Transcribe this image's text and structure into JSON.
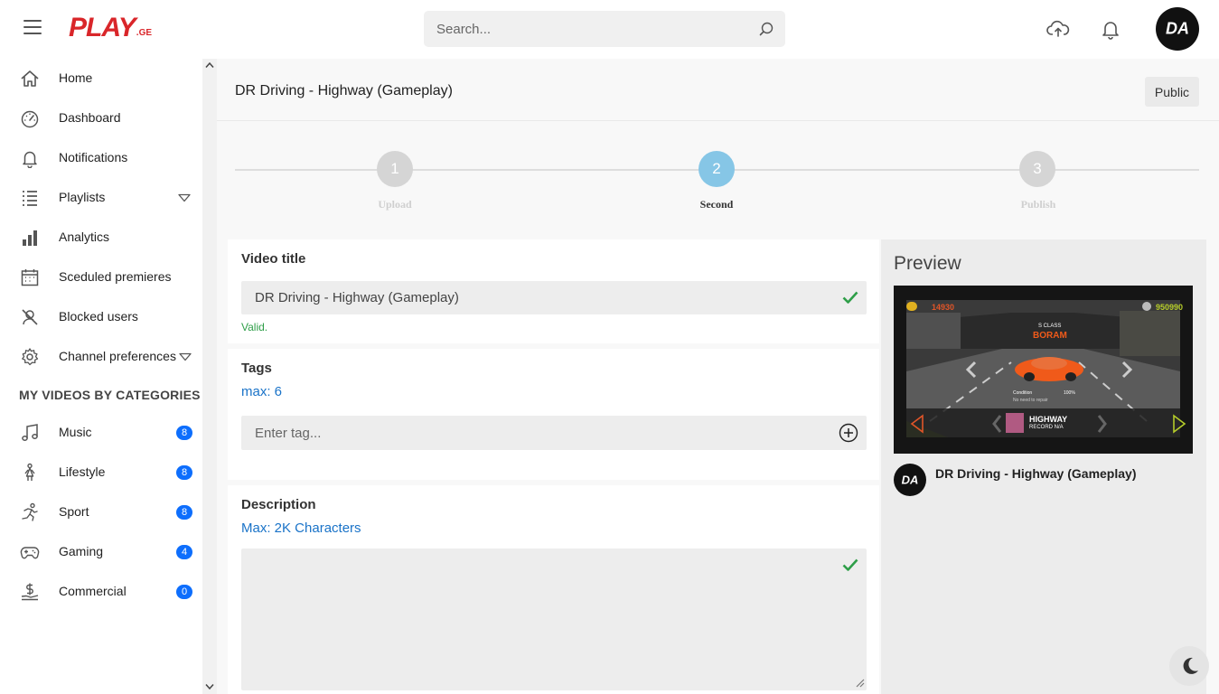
{
  "brand": {
    "logo_text": "PLAY",
    "logo_suffix": ".GE",
    "avatar_text": "DA"
  },
  "search": {
    "placeholder": "Search..."
  },
  "sidebar": {
    "items": [
      {
        "label": "Home",
        "icon": "home-icon"
      },
      {
        "label": "Dashboard",
        "icon": "speedometer-icon"
      },
      {
        "label": "Notifications",
        "icon": "bell-icon"
      },
      {
        "label": "Playlists",
        "icon": "list-icon"
      },
      {
        "label": "Analytics",
        "icon": "bar-chart-icon"
      },
      {
        "label": "Sceduled premieres",
        "icon": "calendar-icon"
      },
      {
        "label": "Blocked users",
        "icon": "blocked-user-icon"
      },
      {
        "label": "Channel preferences",
        "icon": "gear-icon"
      }
    ],
    "section_title": "MY VIDEOS BY CATEGORIES",
    "categories": [
      {
        "label": "Music",
        "count": "8",
        "icon": "music-icon"
      },
      {
        "label": "Lifestyle",
        "count": "8",
        "icon": "lifestyle-icon"
      },
      {
        "label": "Sport",
        "count": "8",
        "icon": "running-icon"
      },
      {
        "label": "Gaming",
        "count": "4",
        "icon": "gamepad-icon"
      },
      {
        "label": "Commercial",
        "count": "0",
        "icon": "dollar-icon"
      }
    ]
  },
  "header": {
    "title": "DR Driving - Highway (Gameplay)",
    "visibility": "Public"
  },
  "steps": [
    {
      "number": "1",
      "label": "Upload"
    },
    {
      "number": "2",
      "label": "Second"
    },
    {
      "number": "3",
      "label": "Publish"
    }
  ],
  "form": {
    "video_title_label": "Video title",
    "video_title_value": "DR Driving - Highway (Gameplay)",
    "valid_text": "Valid.",
    "tags_label": "Tags",
    "tags_hint": "max: 6",
    "tags_placeholder": "Enter tag...",
    "description_label": "Description",
    "description_hint": "Max: 2K Characters",
    "description_value": ""
  },
  "preview": {
    "heading": "Preview",
    "video_title": "DR Driving - Highway (Gameplay)",
    "thumb": {
      "score_left": "14930",
      "score_right": "950990",
      "class_text": "S CLASS",
      "car_name": "BORAM",
      "condition_label": "Condition",
      "condition_value": "100%",
      "repair_text": "No need to repair",
      "mode_title": "HIGHWAY",
      "mode_record": "RECORD N/A"
    }
  },
  "colors": {
    "brand_red": "#d9262a",
    "accent_blue": "#0d6efd",
    "step_active": "#86c6e6",
    "valid_green": "#2e9e48",
    "link_blue": "#1a73c8"
  }
}
